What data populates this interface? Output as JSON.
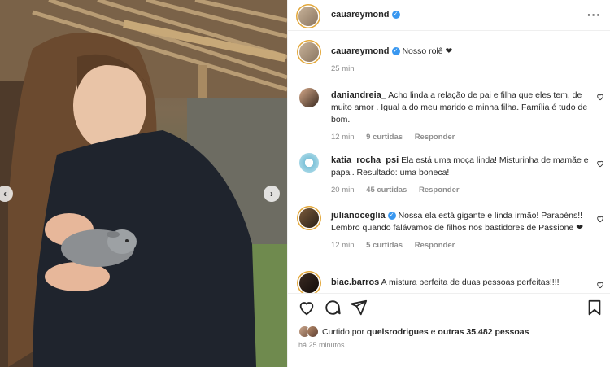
{
  "header": {
    "username": "cauareymond",
    "verified_label": "✓"
  },
  "caption": {
    "username": "cauareymond",
    "text": "Nosso rolê ❤",
    "time": "25 min"
  },
  "comments": [
    {
      "username": "daniandreia_",
      "text": "Acho linda a relação de pai e filha que eles tem, de muito amor . Igual a do meu marido e minha filha. Família é tudo de bom.",
      "time": "12 min",
      "likes": "9 curtidas",
      "reply": "Responder"
    },
    {
      "username": "katia_rocha_psi",
      "text": "Ela está uma moça linda! Misturinha de mamãe e papai. Resultado: uma boneca!",
      "time": "20 min",
      "likes": "45 curtidas",
      "reply": "Responder"
    },
    {
      "username": "julianoceglia",
      "text": "Nossa ela está gigante e linda irmão! Parabéns!! Lembro quando falávamos de filhos nos bastidores de Passione ❤",
      "time": "12 min",
      "likes": "5 curtidas",
      "reply": "Responder"
    },
    {
      "username": "biac.barros",
      "text": "A mistura perfeita de duas pessoas perfeitas!!!!",
      "time": "",
      "likes": "",
      "reply": ""
    }
  ],
  "likes": {
    "prefix": "Curtido por",
    "user": "quelsrodrigues",
    "middle": "e",
    "others": "outras 35.482 pessoas"
  },
  "posted": "há 25 minutos",
  "icons": {
    "heart": "heart-icon",
    "comment": "comment-icon",
    "share": "share-icon",
    "save": "bookmark-icon",
    "more": "more-icon",
    "prev": "chevron-left-icon",
    "next": "chevron-right-icon"
  },
  "nav": {
    "prev": "‹",
    "next": "›",
    "more": "···"
  },
  "colors": {
    "verified": "#3897f0",
    "ring": "#e3a83b",
    "muted": "#8e8e8e"
  }
}
